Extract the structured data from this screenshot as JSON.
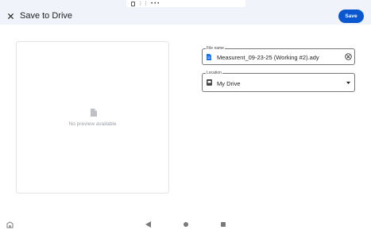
{
  "app": {
    "title": "Save to Drive",
    "save_label": "Save",
    "accent_color": "#0b57d0"
  },
  "status_bar": {
    "icons": [
      "note-icon",
      "signal-dots-icon"
    ],
    "glyph_text": "⋮⋮ •••"
  },
  "preview": {
    "message": "No preview available",
    "icon": "document-icon"
  },
  "file_name": {
    "label": "File name",
    "value": "Measurent_09-23-25 (Working #2).ady",
    "icon": "file-icon",
    "clear_icon": "clear-circle-icon"
  },
  "location": {
    "label": "Location",
    "value": "My Drive",
    "icon": "drive-icon",
    "dropdown_icon": "chevron-down-icon"
  },
  "nav_bar": {
    "icons": [
      "accessibility-icon",
      "back-icon",
      "home-icon",
      "recents-icon"
    ]
  }
}
